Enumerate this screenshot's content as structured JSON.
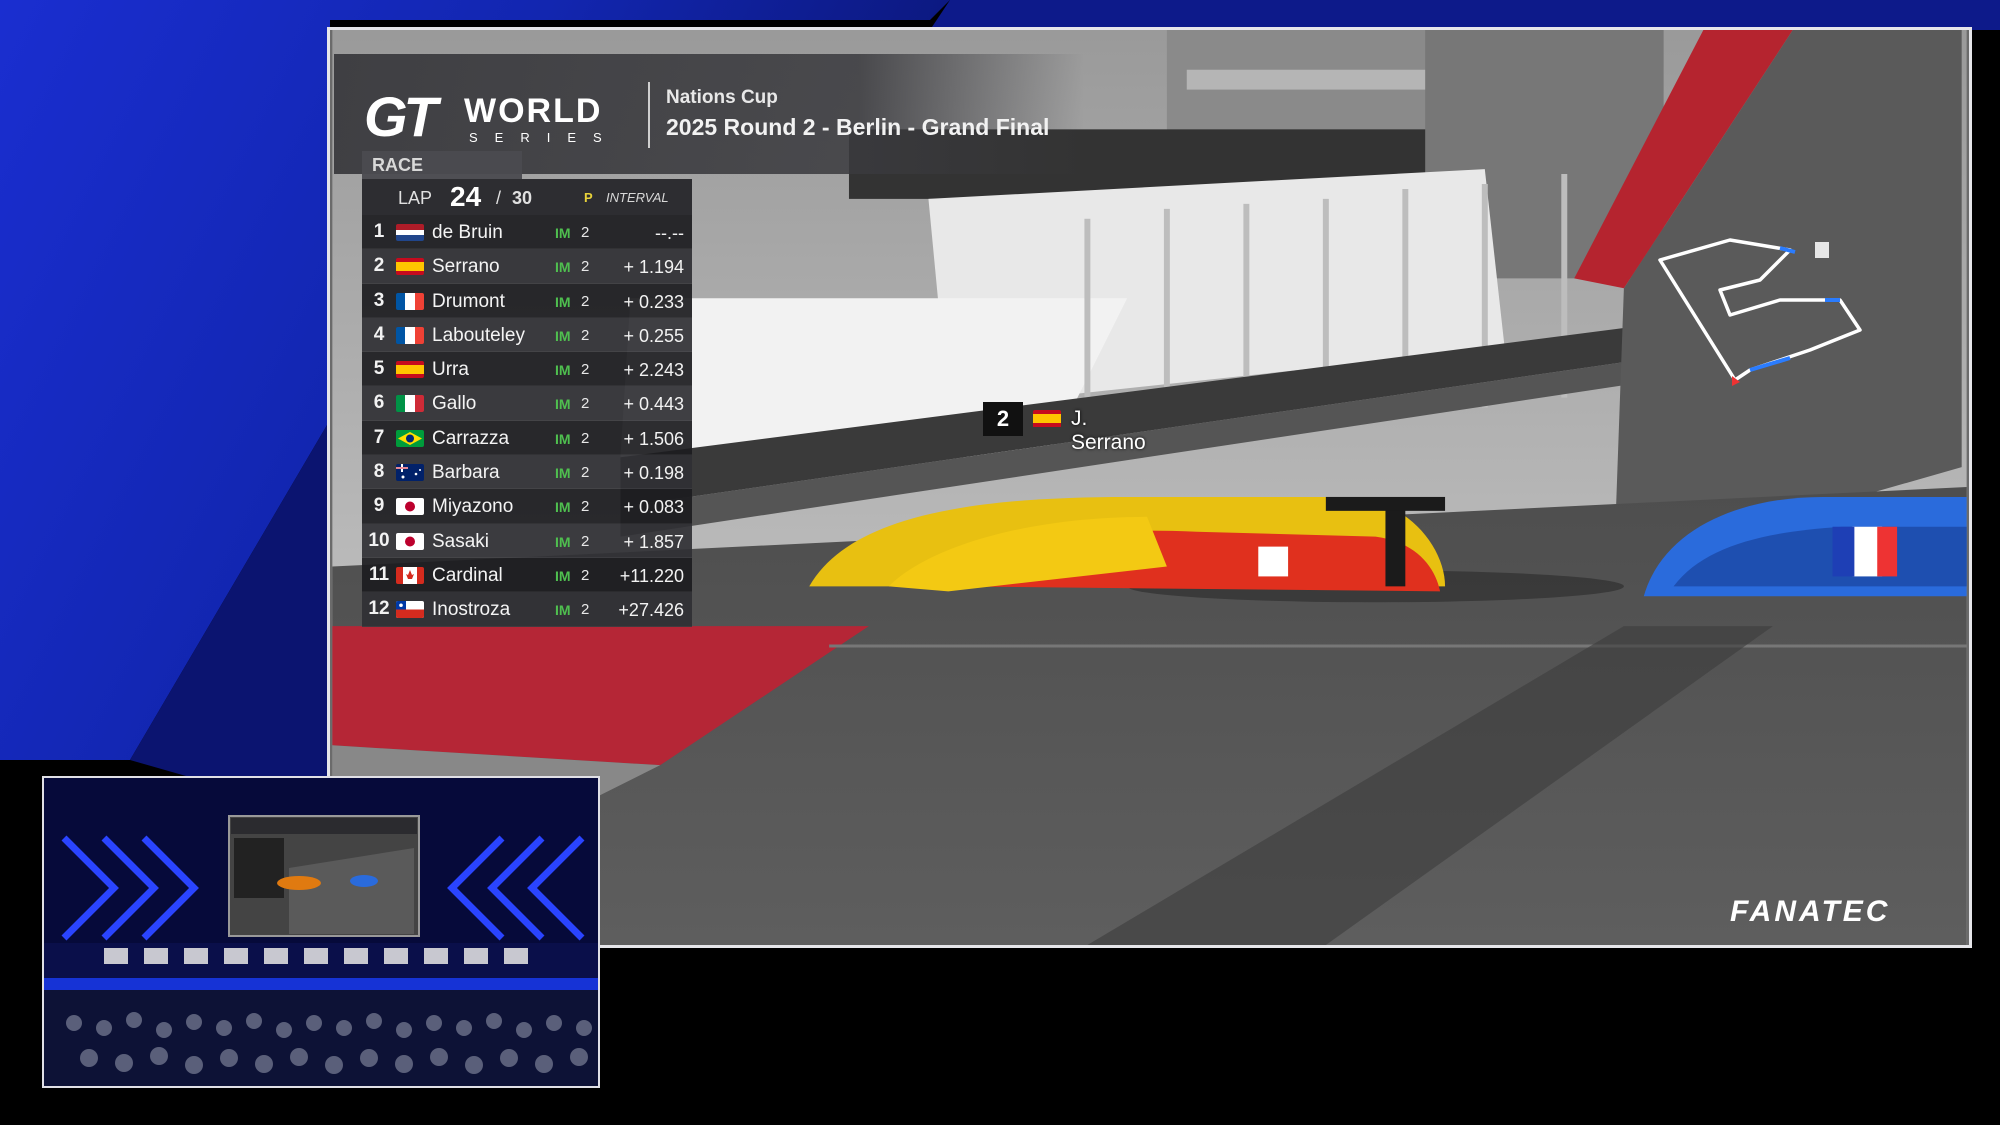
{
  "header": {
    "logo_main": "WORLD",
    "logo_sub": "SERIES",
    "event_cup": "Nations Cup",
    "event_title": "2025 Round 2 - Berlin - Grand Final"
  },
  "board": {
    "tab_label": "RACE",
    "lap_label": "LAP",
    "lap_current": "24",
    "lap_separator": "/",
    "lap_total": "30",
    "col_p": "P",
    "col_interval": "INTERVAL",
    "rows": [
      {
        "pos": "1",
        "flag": "nl",
        "name": "de Bruin",
        "tyre": "IM",
        "stint": "2",
        "interval": "--.--"
      },
      {
        "pos": "2",
        "flag": "es",
        "name": "Serrano",
        "tyre": "IM",
        "stint": "2",
        "interval": "+ 1.194"
      },
      {
        "pos": "3",
        "flag": "fr",
        "name": "Drumont",
        "tyre": "IM",
        "stint": "2",
        "interval": "+ 0.233"
      },
      {
        "pos": "4",
        "flag": "fr",
        "name": "Labouteley",
        "tyre": "IM",
        "stint": "2",
        "interval": "+ 0.255"
      },
      {
        "pos": "5",
        "flag": "es",
        "name": "Urra",
        "tyre": "IM",
        "stint": "2",
        "interval": "+ 2.243"
      },
      {
        "pos": "6",
        "flag": "it",
        "name": "Gallo",
        "tyre": "IM",
        "stint": "2",
        "interval": "+ 0.443"
      },
      {
        "pos": "7",
        "flag": "br",
        "name": "Carrazza",
        "tyre": "IM",
        "stint": "2",
        "interval": "+ 1.506"
      },
      {
        "pos": "8",
        "flag": "au",
        "name": "Barbara",
        "tyre": "IM",
        "stint": "2",
        "interval": "+ 0.198"
      },
      {
        "pos": "9",
        "flag": "jp",
        "name": "Miyazono",
        "tyre": "IM",
        "stint": "2",
        "interval": "+ 0.083"
      },
      {
        "pos": "10",
        "flag": "jp",
        "name": "Sasaki",
        "tyre": "IM",
        "stint": "2",
        "interval": "+ 1.857"
      },
      {
        "pos": "11",
        "flag": "ca",
        "name": "Cardinal",
        "tyre": "IM",
        "stint": "2",
        "interval": "+11.220"
      },
      {
        "pos": "12",
        "flag": "cl",
        "name": "Inostroza",
        "tyre": "IM",
        "stint": "2",
        "interval": "+27.426"
      }
    ]
  },
  "driver_tag": {
    "pos": "2",
    "flag": "es",
    "name": "J. Serrano"
  },
  "sponsor": "FANATEC",
  "colors": {
    "brand_blue": "#1d3fd6",
    "tyre_green": "#4fbf4f",
    "p_yellow": "#e8d23a"
  }
}
